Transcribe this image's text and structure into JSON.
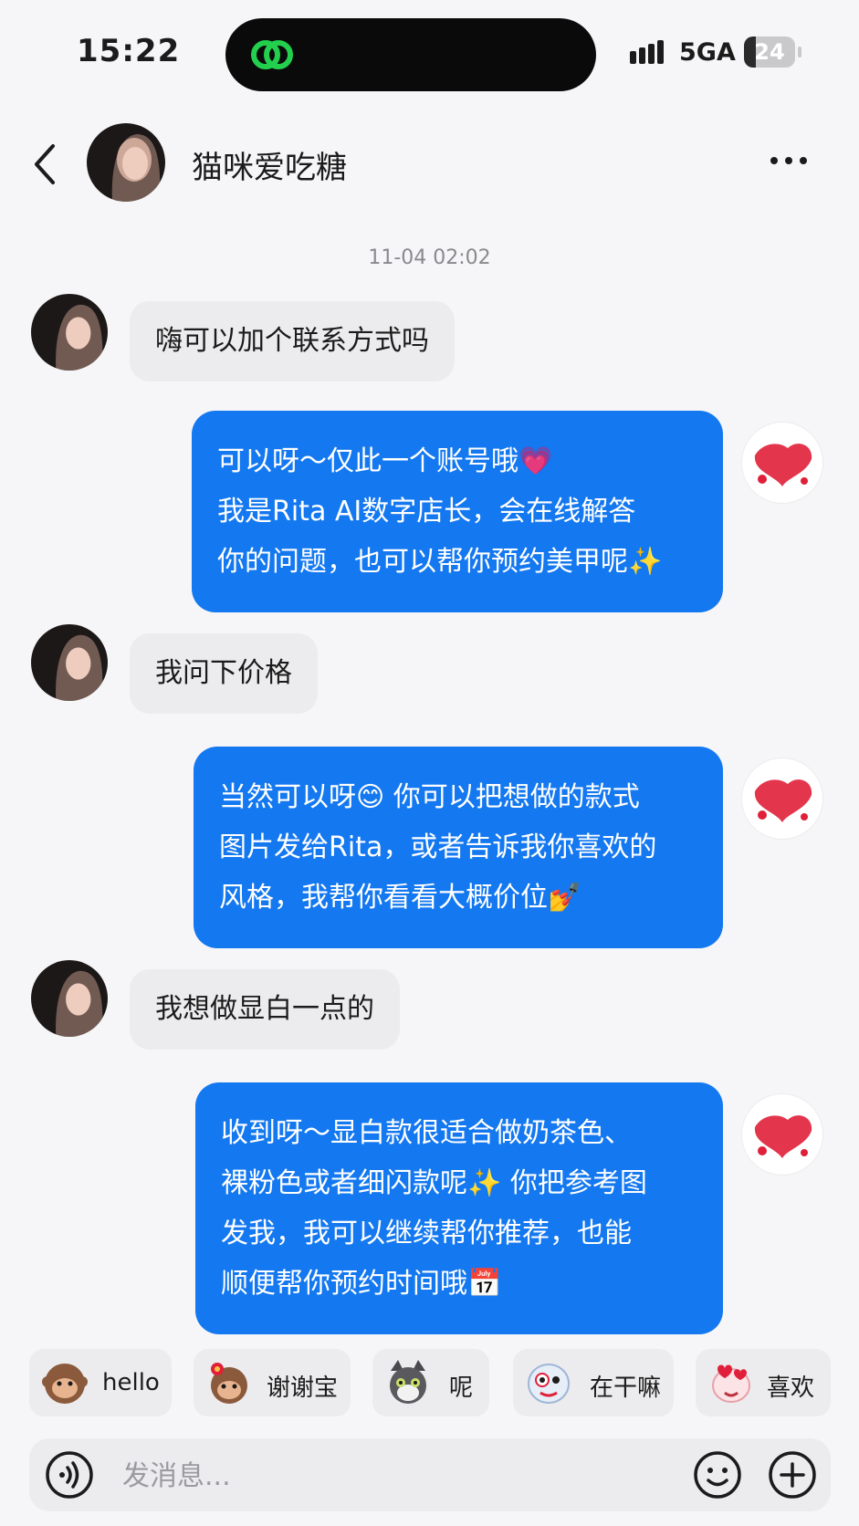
{
  "status_bar": {
    "time": "15:22",
    "network": "5GA",
    "battery_text": "24",
    "battery_level": 0.24
  },
  "header": {
    "contact_name": "猫咪爱吃糖"
  },
  "chat": {
    "timestamp": "11-04 02:02",
    "messages": [
      {
        "from": "user",
        "lines": [
          "嗨可以加个联系方式吗"
        ]
      },
      {
        "from": "shop",
        "lines": [
          "可以呀～仅此一个账号哦💗",
          "我是Rita AI数字店长，会在线解答",
          "你的问题，也可以帮你预约美甲呢✨"
        ]
      },
      {
        "from": "user",
        "lines": [
          "我问下价格"
        ]
      },
      {
        "from": "shop",
        "lines": [
          "当然可以呀😊 你可以把想做的款式",
          "图片发给Rita，或者告诉我你喜欢的",
          "风格，我帮你看看大概价位💅"
        ]
      },
      {
        "from": "user",
        "lines": [
          "我想做显白一点的"
        ]
      },
      {
        "from": "shop",
        "lines": [
          "收到呀～显白款很适合做奶茶色、",
          "裸粉色或者细闪款呢✨ 你把参考图",
          "发我，我可以继续帮你推荐，也能",
          "顺便帮你预约时间哦📅"
        ]
      }
    ]
  },
  "quick_stickers": [
    {
      "label": "hello",
      "icon": "monkey-sticker-icon"
    },
    {
      "label": "谢谢宝",
      "icon": "monkey-flower-sticker-icon"
    },
    {
      "label": "呢",
      "icon": "cat-sticker-icon"
    },
    {
      "label": "在干嘛",
      "icon": "blob-sticker-icon"
    },
    {
      "label": "喜欢",
      "icon": "heart-blob-sticker-icon"
    }
  ],
  "input": {
    "placeholder": "发消息..."
  },
  "colors": {
    "outgoing_bubble": "#1478f0",
    "incoming_bubble": "#ececee",
    "background": "#f6f6f8",
    "shop_logo_red": "#e0203a"
  }
}
